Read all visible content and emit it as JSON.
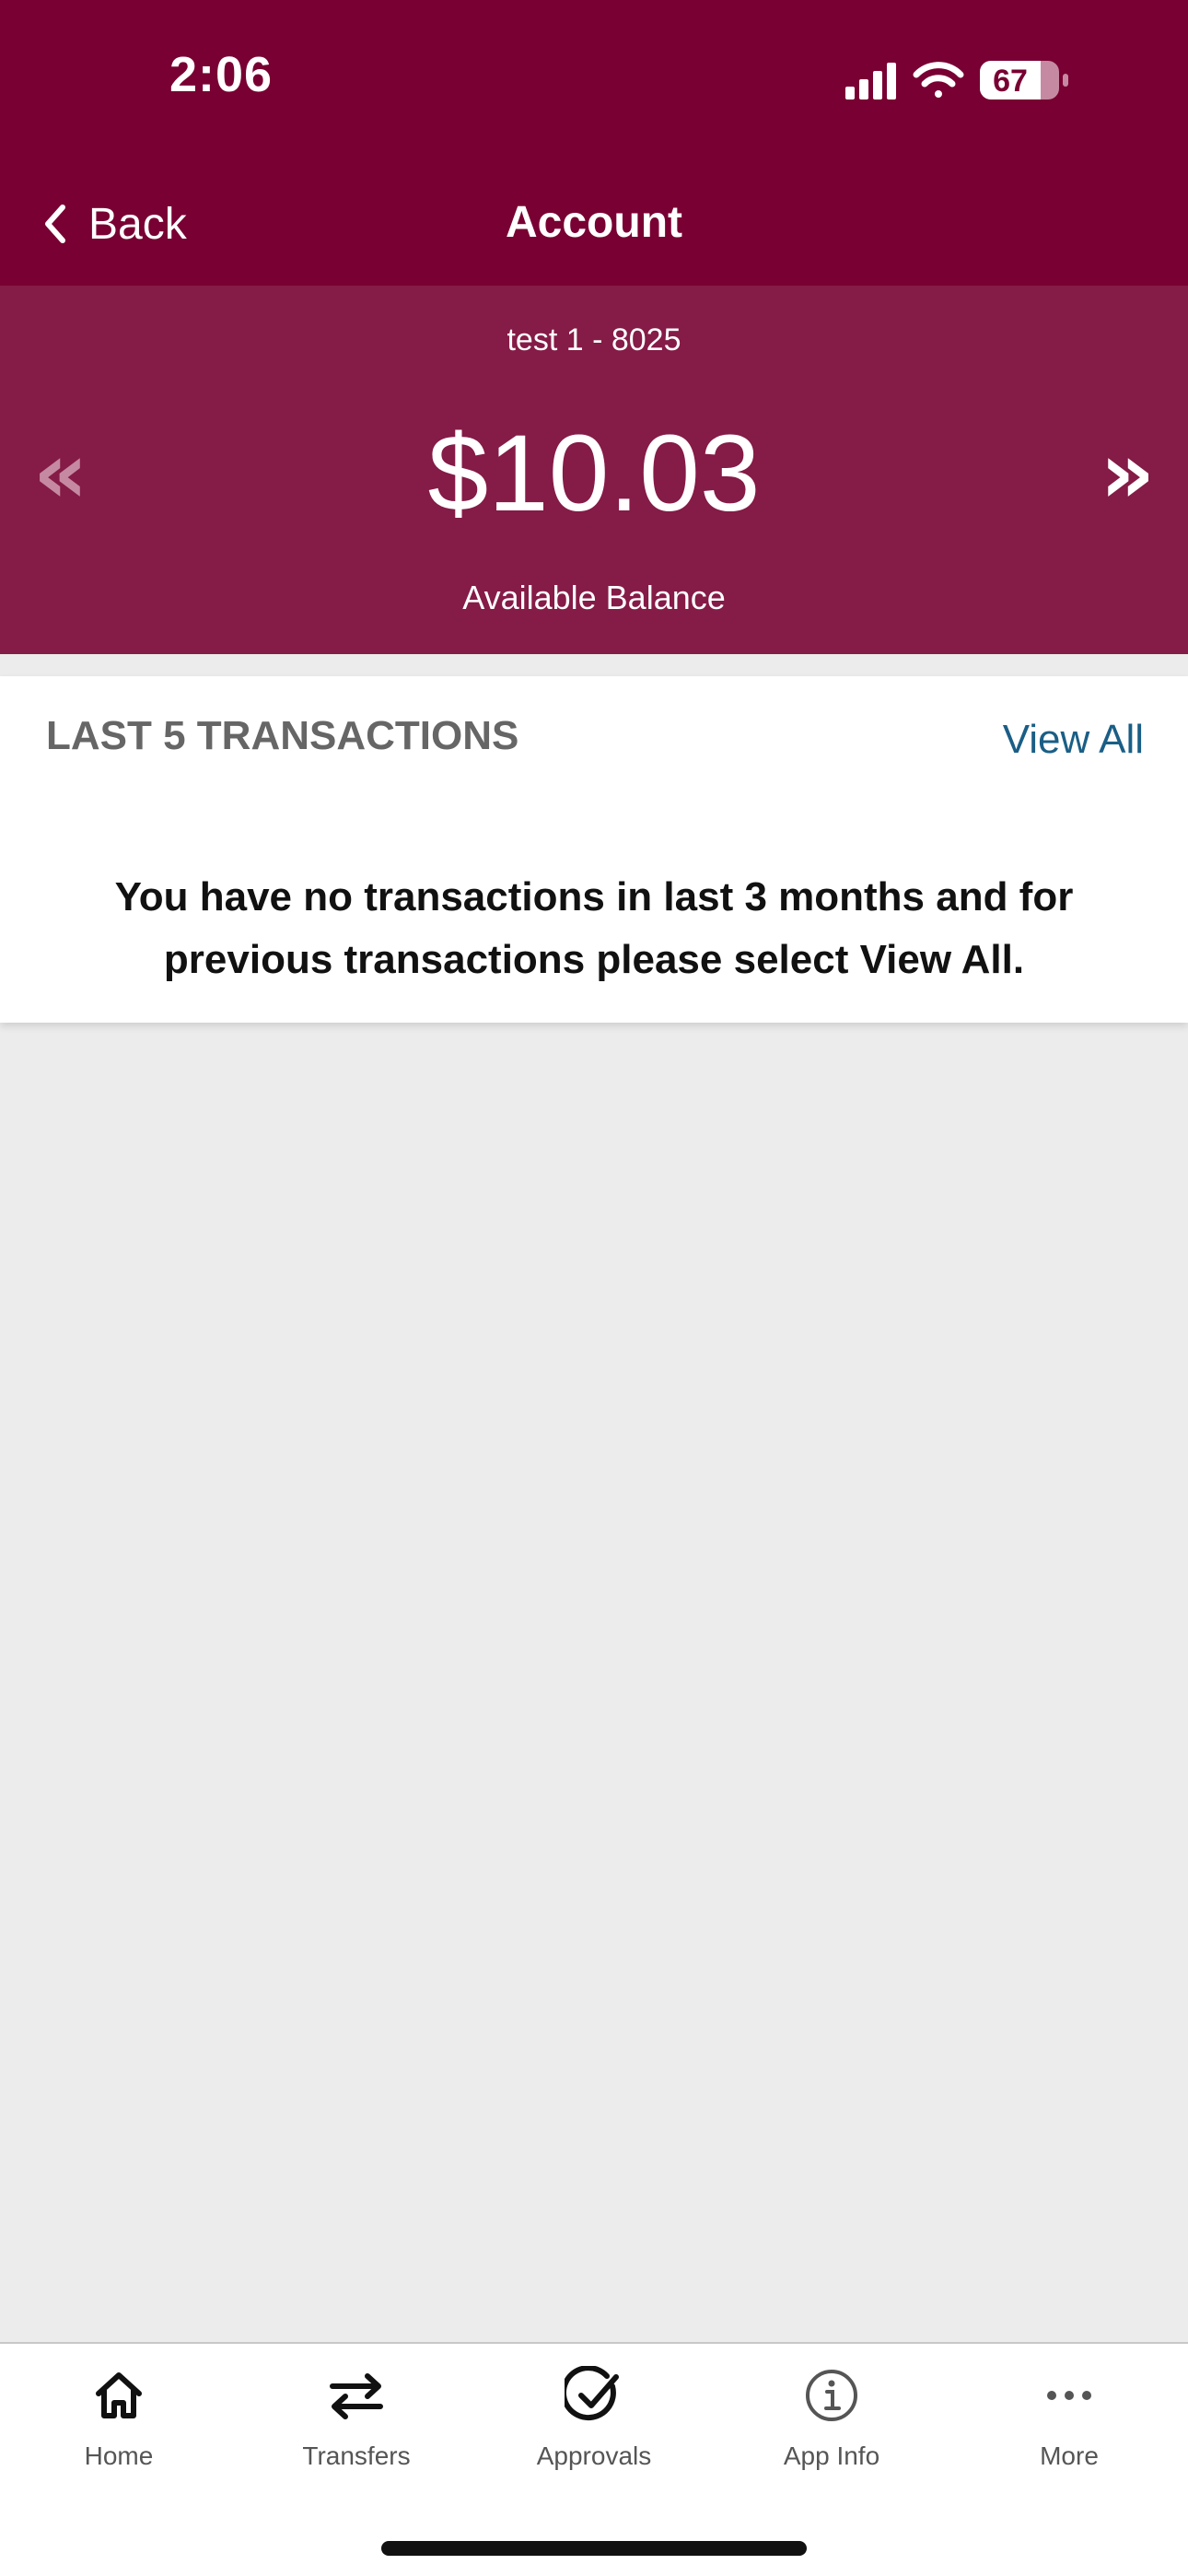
{
  "status_bar": {
    "time": "2:06",
    "battery": "67",
    "icons": [
      "cellular-signal-icon",
      "wifi-icon",
      "battery-icon"
    ]
  },
  "nav": {
    "back_label": "Back",
    "title": "Account"
  },
  "account": {
    "name": "test 1 - 8025",
    "balance": "$10.03",
    "balance_label": "Available Balance",
    "prev_glyph": "«",
    "next_glyph": "»"
  },
  "transactions": {
    "title": "LAST 5 TRANSACTIONS",
    "view_all": "View All",
    "empty_message": "You have no transactions in last 3 months and for previous transactions please select View All."
  },
  "tabs": [
    {
      "label": "Home",
      "icon": "home-icon"
    },
    {
      "label": "Transfers",
      "icon": "transfer-arrows-icon"
    },
    {
      "label": "Approvals",
      "icon": "check-circle-icon"
    },
    {
      "label": "App Info",
      "icon": "info-circle-icon"
    },
    {
      "label": "More",
      "icon": "more-dots-icon"
    }
  ],
  "colors": {
    "header": "#780032",
    "balance_panel": "#851b47",
    "link": "#1a5e86",
    "background": "#ececec"
  }
}
